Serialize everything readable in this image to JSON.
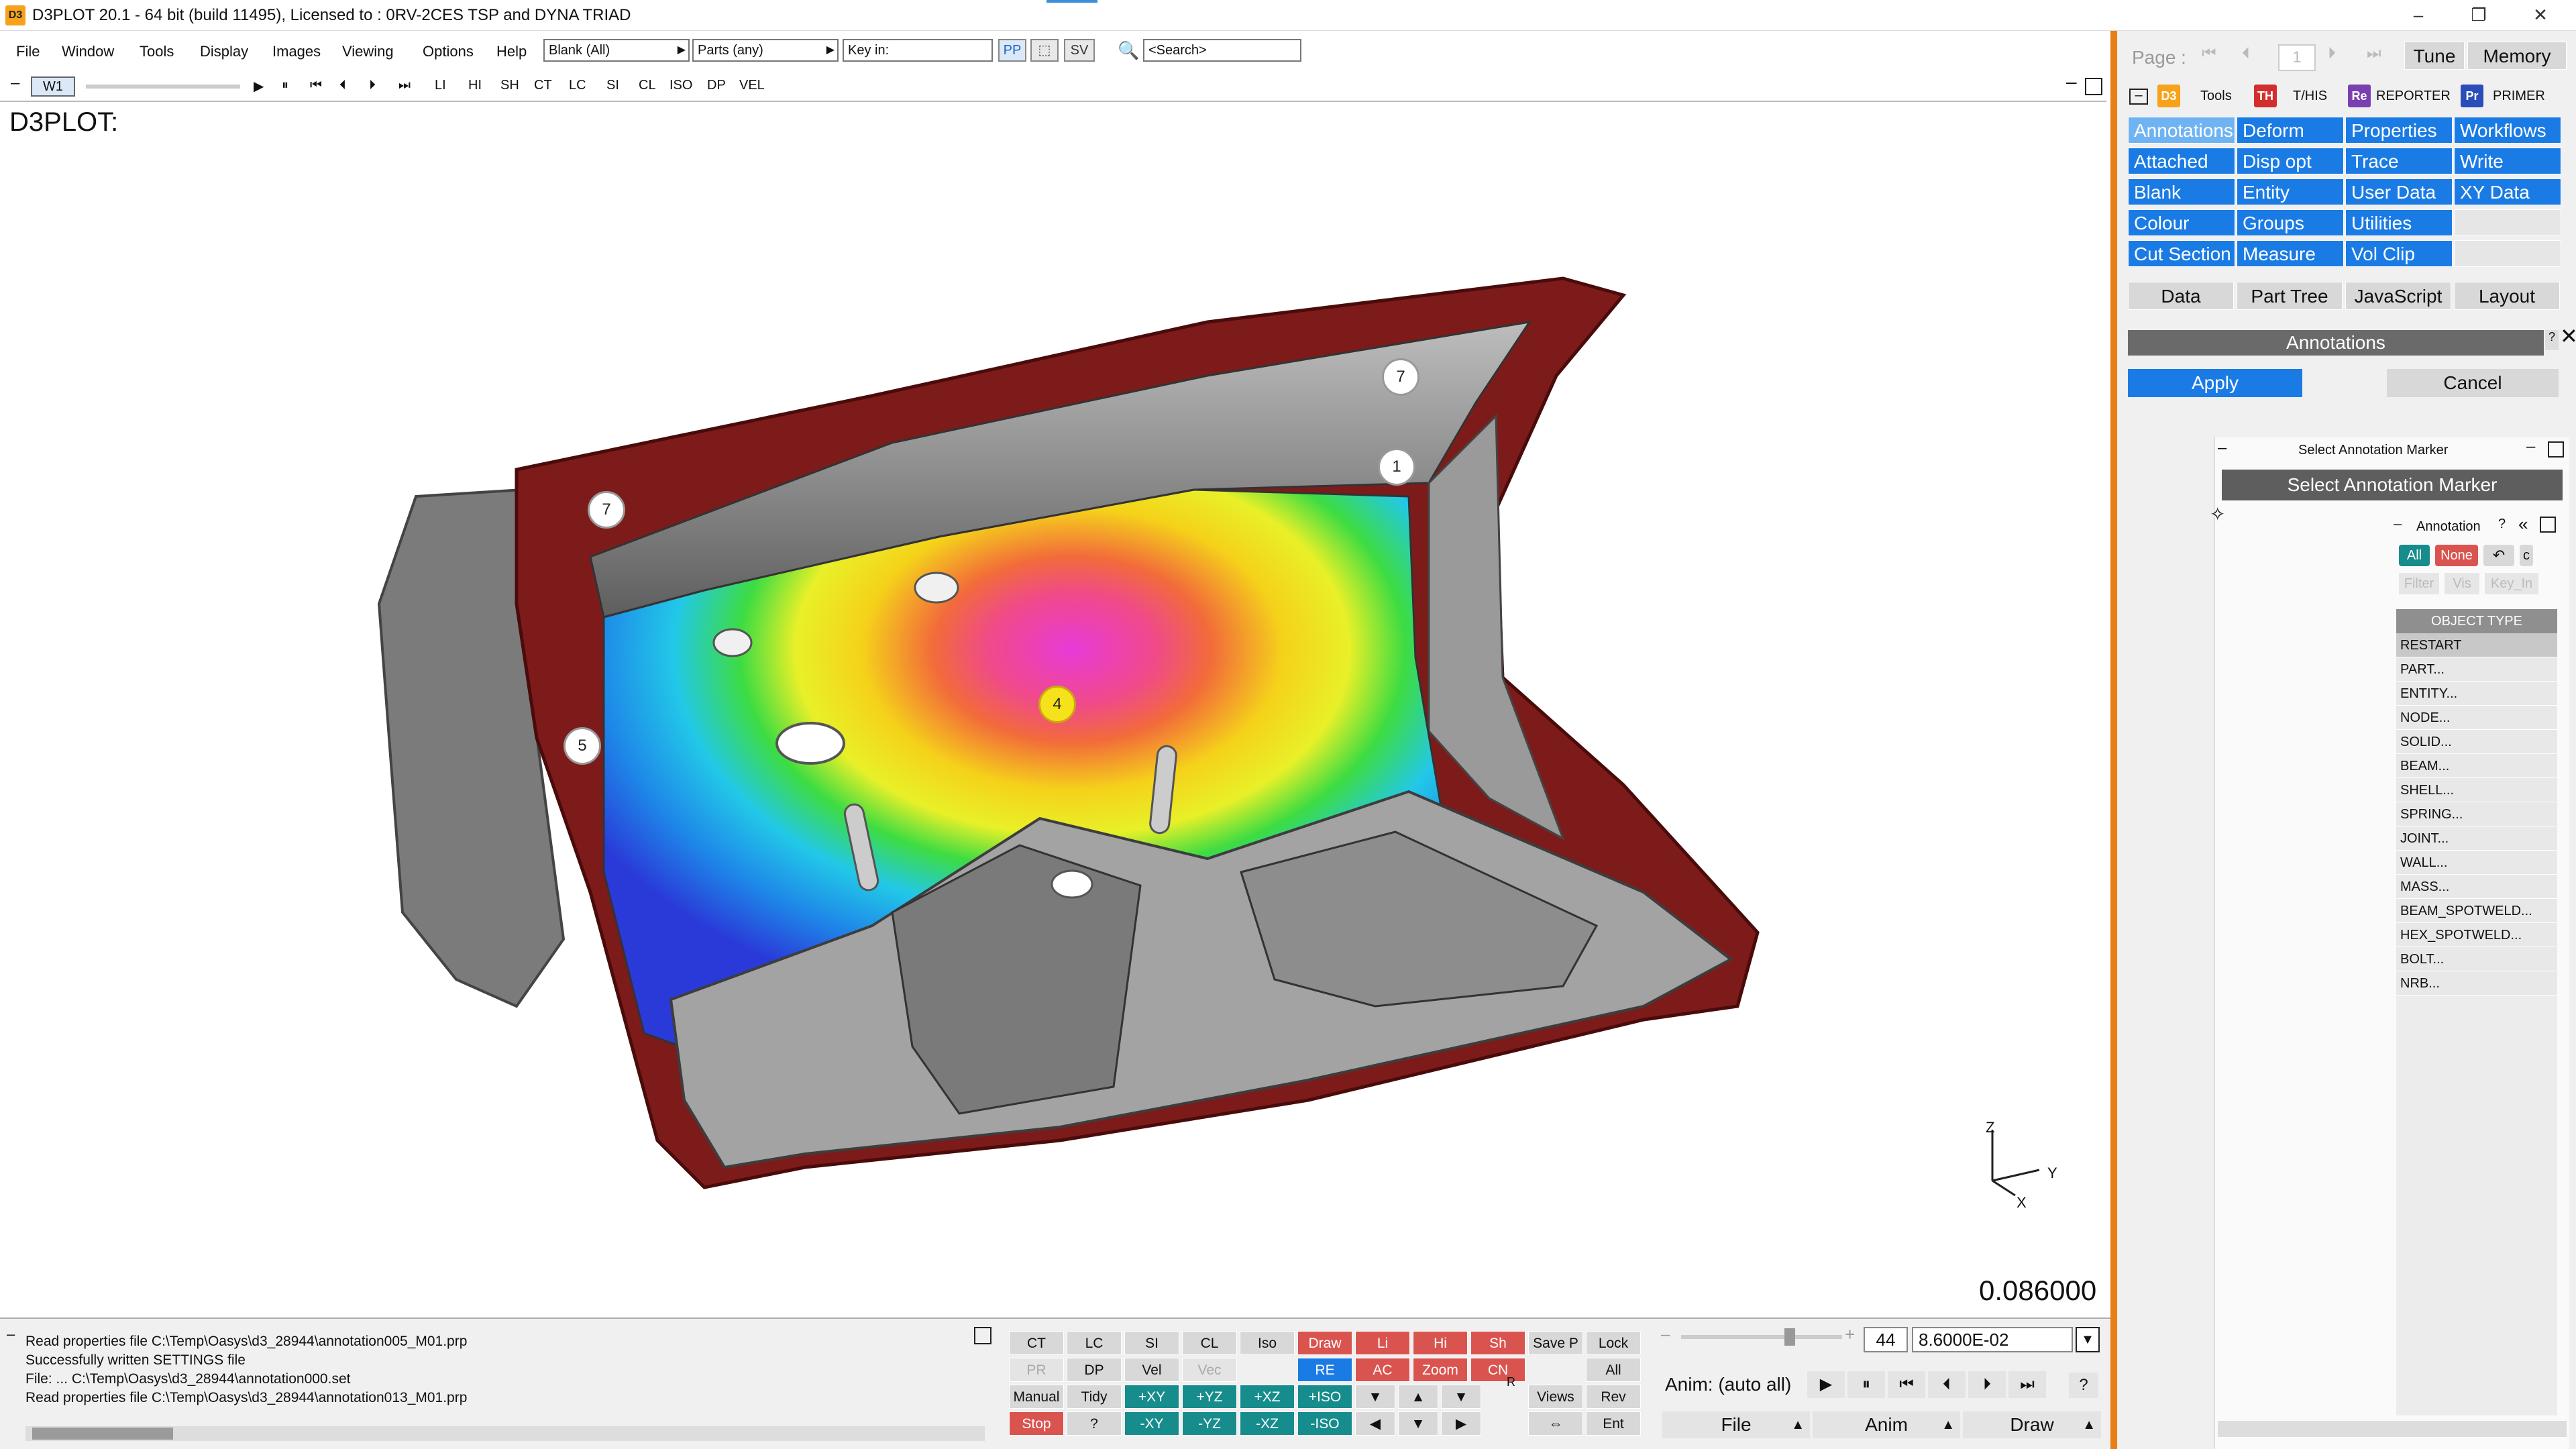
{
  "window": {
    "title": "D3PLOT 20.1 - 64 bit (build 11495), Licensed to : 0RV-2CES TSP and DYNA TRIAD",
    "logo": "D3",
    "minimize": "–",
    "restore": "❐",
    "close": "✕"
  },
  "menu": {
    "items": [
      "File",
      "Window",
      "Tools",
      "Display",
      "Images",
      "Viewing",
      "Options",
      "Help"
    ],
    "blank_select": "Blank (All)",
    "parts_select": "Parts (any)",
    "keyin_value": "Key in:",
    "pp": "PP",
    "sv": "SV",
    "search_placeholder": "<Search>"
  },
  "viewport_toolbar": {
    "window_tab": "W1",
    "play_buttons": [
      "▶",
      "⏸",
      "⏮",
      "⏴",
      "⏵",
      "⏭"
    ],
    "modes": [
      "LI",
      "HI",
      "SH",
      "CT",
      "LC",
      "SI",
      "CL",
      "ISO",
      "DP",
      "VEL"
    ]
  },
  "graphics": {
    "title": "D3PLOT:",
    "time_value": "0.086000",
    "axis_labels": {
      "z": "Z",
      "y": "Y",
      "x": "X"
    },
    "markers": [
      "7",
      "1",
      "7",
      "5",
      "4"
    ]
  },
  "right_panel": {
    "page_label": "Page :",
    "page_value": "1",
    "tune": "Tune",
    "memory": "Memory",
    "product_tabs": [
      {
        "logo": "D3",
        "label": "Tools",
        "color": "#f7a21b"
      },
      {
        "logo": "TH",
        "label": "T/HIS",
        "color": "#d42d2d"
      },
      {
        "logo": "Re",
        "label": "REPORTER",
        "color": "#7a3fb0"
      },
      {
        "logo": "Pr",
        "label": "PRIMER",
        "color": "#2a4db8"
      }
    ],
    "tool_grid": [
      [
        "Annotations",
        "Deform",
        "Properties",
        "Workflows"
      ],
      [
        "Attached",
        "Disp opt",
        "Trace",
        "Write"
      ],
      [
        "Blank",
        "Entity",
        "User Data",
        "XY Data"
      ],
      [
        "Colour",
        "Groups",
        "Utilities",
        ""
      ],
      [
        "Cut Section",
        "Measure",
        "Vol Clip",
        ""
      ]
    ],
    "bottom_tabs": [
      "Data",
      "Part Tree",
      "JavaScript",
      "Layout"
    ],
    "annotations_header": "Annotations",
    "apply": "Apply",
    "cancel": "Cancel",
    "select_marker_title": "Select Annotation Marker",
    "select_marker_button": "Select Annotation Marker",
    "annotation_sub_title": "Annotation",
    "all": "All",
    "none": "None",
    "filter": "Filter",
    "vis": "Vis",
    "keyin": "Key_In",
    "object_type_header": "OBJECT TYPE",
    "object_types": [
      "RESTART",
      "PART...",
      "ENTITY...",
      "NODE...",
      "SOLID...",
      "BEAM...",
      "SHELL...",
      "SPRING...",
      "JOINT...",
      "WALL...",
      "MASS...",
      "BEAM_SPOTWELD...",
      "HEX_SPOTWELD...",
      "BOLT...",
      "NRB..."
    ]
  },
  "log": {
    "lines": [
      "Read properties file C:\\Temp\\Oasys\\d3_28944\\annotation005_M01.prp",
      "Successfully written SETTINGS file",
      "File: ... C:\\Temp\\Oasys\\d3_28944\\annotation000.set",
      "Read properties file C:\\Temp\\Oasys\\d3_28944\\annotation013_M01.prp"
    ]
  },
  "controls": {
    "row1": [
      "CT",
      "LC",
      "SI",
      "CL",
      "Iso",
      "Draw",
      "Li",
      "Hi",
      "Sh",
      "Save P",
      "Lock"
    ],
    "row2": [
      "PR",
      "DP",
      "Vel",
      "Vec",
      "RE",
      "AC",
      "Zoom",
      "CN",
      "All"
    ],
    "row3": [
      "Manual",
      "Tidy",
      "+XY",
      "+YZ",
      "+XZ",
      "+ISO",
      "Views",
      "Rev"
    ],
    "row4": [
      "Stop",
      "?",
      "-XY",
      "-YZ",
      "-XZ",
      "-ISO",
      "Ent"
    ],
    "r_label": "R"
  },
  "animation": {
    "frame": "44",
    "time": "8.6000E-02",
    "anim_label": "Anim: (auto all)",
    "help": "?",
    "file": "File",
    "anim": "Anim",
    "draw": "Draw",
    "play_buttons": [
      "▶",
      "⏸",
      "⏮",
      "⏴",
      "⏵",
      "⏭"
    ]
  }
}
